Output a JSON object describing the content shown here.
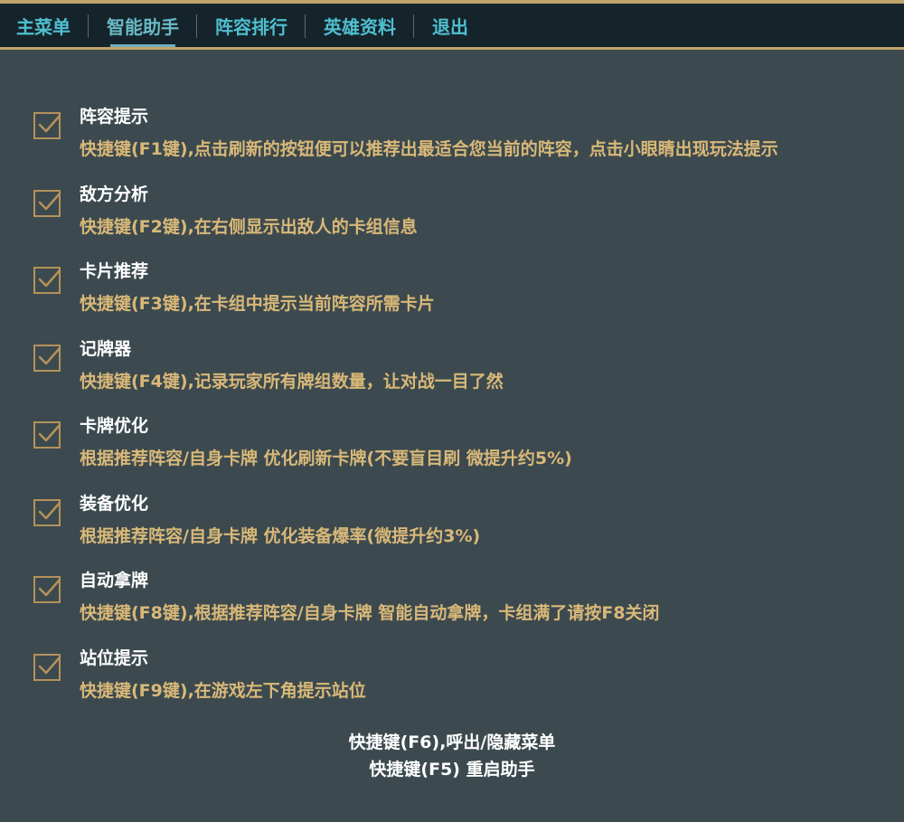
{
  "tabs": [
    {
      "label": "主菜单"
    },
    {
      "label": "智能助手"
    },
    {
      "label": "阵容排行"
    },
    {
      "label": "英雄资料"
    },
    {
      "label": "退出"
    }
  ],
  "active_tab": "智能助手",
  "options": [
    {
      "title": "阵容提示",
      "desc": "快捷键(F1键),点击刷新的按钮便可以推荐出最适合您当前的阵容，点击小眼睛出现玩法提示",
      "checked": true
    },
    {
      "title": "敌方分析",
      "desc": "快捷键(F2键),在右侧显示出敌人的卡组信息",
      "checked": true
    },
    {
      "title": "卡片推荐",
      "desc": "快捷键(F3键),在卡组中提示当前阵容所需卡片",
      "checked": true
    },
    {
      "title": "记牌器",
      "desc": "快捷键(F4键),记录玩家所有牌组数量，让对战一目了然",
      "checked": true
    },
    {
      "title": "卡牌优化",
      "desc": "根据推荐阵容/自身卡牌 优化刷新卡牌(不要盲目刷 微提升约5%)",
      "checked": true
    },
    {
      "title": "装备优化",
      "desc": "根据推荐阵容/自身卡牌 优化装备爆率(微提升约3%)",
      "checked": true
    },
    {
      "title": "自动拿牌",
      "desc": "快捷键(F8键),根据推荐阵容/自身卡牌 智能自动拿牌，卡组满了请按F8关闭",
      "checked": true
    },
    {
      "title": "站位提示",
      "desc": "快捷键(F9键),在游戏左下角提示站位",
      "checked": true
    }
  ],
  "footer": {
    "line1": "快捷键(F6),呼出/隐藏菜单",
    "line2": "快捷键(F5) 重启助手"
  },
  "colors": {
    "background": "#3c4a4f",
    "topbar": "#15242a",
    "gold_border": "#bfa46a",
    "tab_text": "#4fbfd0",
    "title_text": "#ffffff",
    "desc_text": "#d9b878",
    "checkbox": "#b4925a"
  },
  "icons": {
    "checkbox": "checkmark-icon"
  }
}
